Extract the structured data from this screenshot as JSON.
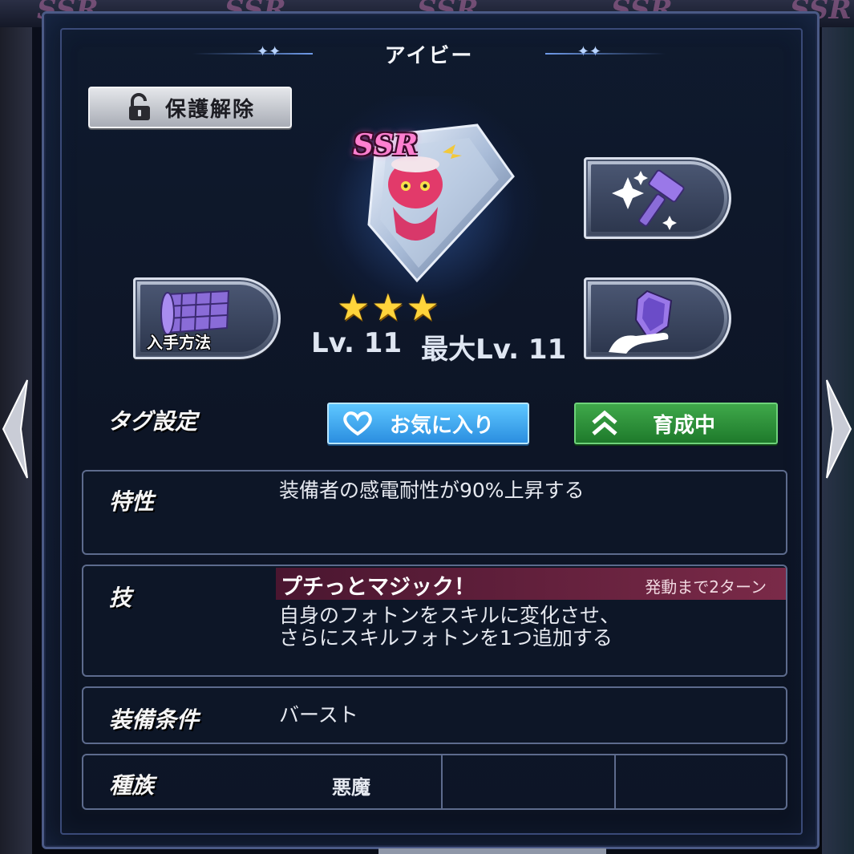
{
  "background": {
    "rarity_watermark": "SSR"
  },
  "panel": {
    "title": "アイビー"
  },
  "lock_button": {
    "label": "保護解除",
    "icon": "unlock-icon"
  },
  "item": {
    "rarity": "SSR",
    "stars": 3,
    "level": "Lv. 11",
    "max_level": "最大Lv. 11"
  },
  "side_buttons": {
    "howto_label": "入手方法",
    "howto_icon": "map-scroll-icon",
    "enhance_icon": "hammer-sparkle-icon",
    "limit_icon": "crystal-hand-icon"
  },
  "tags": {
    "label": "タグ設定",
    "favorite": "お気に入り",
    "favorite_icon": "heart-icon",
    "training": "育成中",
    "training_icon": "double-chevron-up-icon"
  },
  "trait": {
    "label": "特性",
    "text": "装備者の感電耐性が90%上昇する"
  },
  "skill": {
    "label": "技",
    "name": "プチっとマジック！",
    "turns": "発動まで2ターン",
    "desc_line1": "自身のフォトンをスキルに変化させ、",
    "desc_line2": "さらにスキルフォトンを1つ追加する"
  },
  "equip": {
    "label": "装備条件",
    "value": "バースト"
  },
  "race": {
    "label": "種族",
    "value": "悪魔"
  },
  "colors": {
    "favorite_blue": "#2b8ee0",
    "training_green": "#1e7a2b",
    "skill_bar": "#7a2a48",
    "ssr_pink": "#ff7fd0",
    "star_gold": "#ffd43b"
  }
}
